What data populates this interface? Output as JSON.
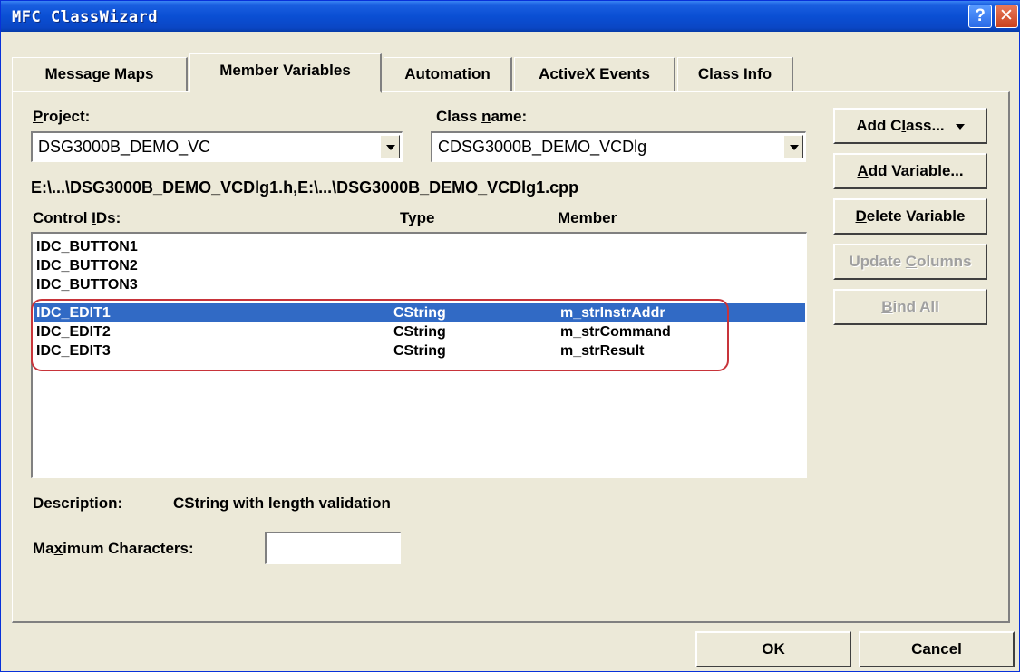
{
  "window": {
    "title": "MFC ClassWizard",
    "help_glyph": "?",
    "close_glyph": "✕"
  },
  "tabs": [
    {
      "label": "Message Maps"
    },
    {
      "label": "Member Variables",
      "active": true
    },
    {
      "label": "Automation"
    },
    {
      "label": "ActiveX Events"
    },
    {
      "label": "Class Info"
    }
  ],
  "project": {
    "label_first": "P",
    "label_rest": "roject:",
    "value": "DSG3000B_DEMO_VC"
  },
  "class_name": {
    "label_pre": "Class ",
    "label_u": "n",
    "label_post": "ame:",
    "value": "CDSG3000B_DEMO_VCDlg"
  },
  "file_path": "E:\\...\\DSG3000B_DEMO_VCDlg1.h,E:\\...\\DSG3000B_DEMO_VCDlg1.cpp",
  "list": {
    "headers": {
      "control_ids_pre": "Control ",
      "control_ids_u": "I",
      "control_ids_post": "Ds:",
      "type": "Type",
      "member": "Member"
    },
    "rows": [
      {
        "id": "IDC_BUTTON1",
        "type": "",
        "member": ""
      },
      {
        "id": "IDC_BUTTON2",
        "type": "",
        "member": ""
      },
      {
        "id": "IDC_BUTTON3",
        "type": "",
        "member": ""
      },
      {
        "id": "IDC_EDIT1",
        "type": "CString",
        "member": "m_strInstrAddr",
        "selected": true
      },
      {
        "id": "IDC_EDIT2",
        "type": "CString",
        "member": "m_strCommand"
      },
      {
        "id": "IDC_EDIT3",
        "type": "CString",
        "member": "m_strResult"
      }
    ]
  },
  "description": {
    "label": "Description:",
    "value": "CString with length validation"
  },
  "max_chars": {
    "label_pre": "Ma",
    "label_u": "x",
    "label_post": "imum Characters:",
    "value": ""
  },
  "buttons": {
    "add_class_pre": "Add C",
    "add_class_u": "l",
    "add_class_post": "ass...",
    "add_variable_u": "A",
    "add_variable_post": "dd Variable...",
    "delete_variable_u": "D",
    "delete_variable_post": "elete Variable",
    "update_columns_pre": "Update ",
    "update_columns_u": "C",
    "update_columns_post": "olumns",
    "bind_all_u": "B",
    "bind_all_post": "ind All",
    "ok": "OK",
    "cancel": "Cancel"
  },
  "colors": {
    "titlebar": "#0a4fd4",
    "selection": "#316ac5",
    "highlight_outline": "#c8343a",
    "dialog_bg": "#ece9d8"
  }
}
